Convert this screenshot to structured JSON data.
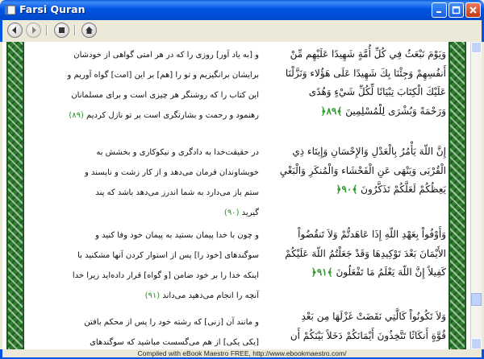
{
  "window": {
    "title": "Farsi Quran"
  },
  "toolbar": {
    "back": "back",
    "forward": "forward",
    "stop": "stop",
    "home": "home"
  },
  "persian": [
    {
      "lines": [
        "و [به یاد آور] روزی را که در هر امتی گواهی از خودشان",
        "برایشان برانگیزیم و تو را [هم] بر این [امت] گواه آوریم و",
        "این کتاب را که روشنگر هر چیزی است و برای مسلمانان",
        "رهنمود و رحمت و بشارتگری است بر تو نازل کردیم"
      ],
      "num": "(۸۹)"
    },
    {
      "lines": [
        "در حقیقت‌خدا به دادگری و نیکوکاری و بخشش به",
        "خویشاوندان فرمان می‌دهد و از کار زشت و ناپسند و",
        "ستم باز می‌دارد به شما اندرز می‌دهد باشد که پند",
        "گیرید"
      ],
      "num": "(۹۰)"
    },
    {
      "lines": [
        "و چون با خدا پیمان بستید به پیمان خود وفا کنید و",
        "سوگندهای [خود را] پس از استوار کردن آنها مشکنید با",
        "اینکه خدا را بر خود ضامن [و گواه] قرار داده‌اید زیرا خدا",
        "آنچه را انجام می‌دهید می‌داند"
      ],
      "num": "(۹۱)"
    },
    {
      "lines": [
        "و مانند آن [زنی] که رشته خود را پس از محکم بافتن",
        "[یکی یکی] از هم می‌گسست مباشید که سوگندهای"
      ],
      "num": ""
    }
  ],
  "arabic": [
    {
      "lines": [
        "وَيَوْمَ نَبْعَثُ فِي كُلِّ أُمَّةٍ شَهِيدًا عَلَيْهِم مِّنْ",
        "أَنفُسِهِمْ وَجِئْنَا بِكَ شَهِيدًا عَلَى هَؤُلاء وَنَزَّلْنَا",
        "عَلَيْكَ الْكِتَابَ تِبْيَانًا لِّكُلِّ شَيْءٍ وَهُدًى",
        "وَرَحْمَةً وَبُشْرَى لِلْمُسْلِمِينَ"
      ],
      "num": "﴿٨٩﴾"
    },
    {
      "lines": [
        "إِنَّ اللّهَ يَأْمُرُ بِالْعَدْلِ وَالإِحْسَانِ وَإِيتَاء ذِي",
        "الْقُرْبَى وَيَنْهَى عَنِ الْفَحْشَاء وَالْمُنكَرِ وَالْبَغْيِ",
        "يَعِظُكُمْ لَعَلَّكُمْ تَذَكَّرُونَ"
      ],
      "num": "﴿٩٠﴾"
    },
    {
      "lines": [
        "وَأَوْفُواْ بِعَهْدِ اللّهِ إِذَا عَاهَدتُّمْ وَلاَ تَنقُضُواْ",
        "الأَيْمَانَ بَعْدَ تَوْكِيدِهَا وَقَدْ جَعَلْتُمُ اللّهَ عَلَيْكُمْ",
        "كَفِيلاً إِنَّ اللّهَ يَعْلَمُ مَا تَفْعَلُونَ"
      ],
      "num": "﴿٩١﴾"
    },
    {
      "lines": [
        "وَلاَ تَكُونُواْ كَالَّتِي نَقَضَتْ غَزْلَهَا مِن بَعْدِ",
        "قُوَّةٍ أَنكَاثًا تَتَّخِذُونَ أَيْمَانَكُمْ دَخَلاً بَيْنَكُمْ أَن"
      ],
      "num": ""
    }
  ],
  "status": {
    "text": "Compiled with eBook Maestro FREE, http://www.ebookmaestro.com/"
  }
}
